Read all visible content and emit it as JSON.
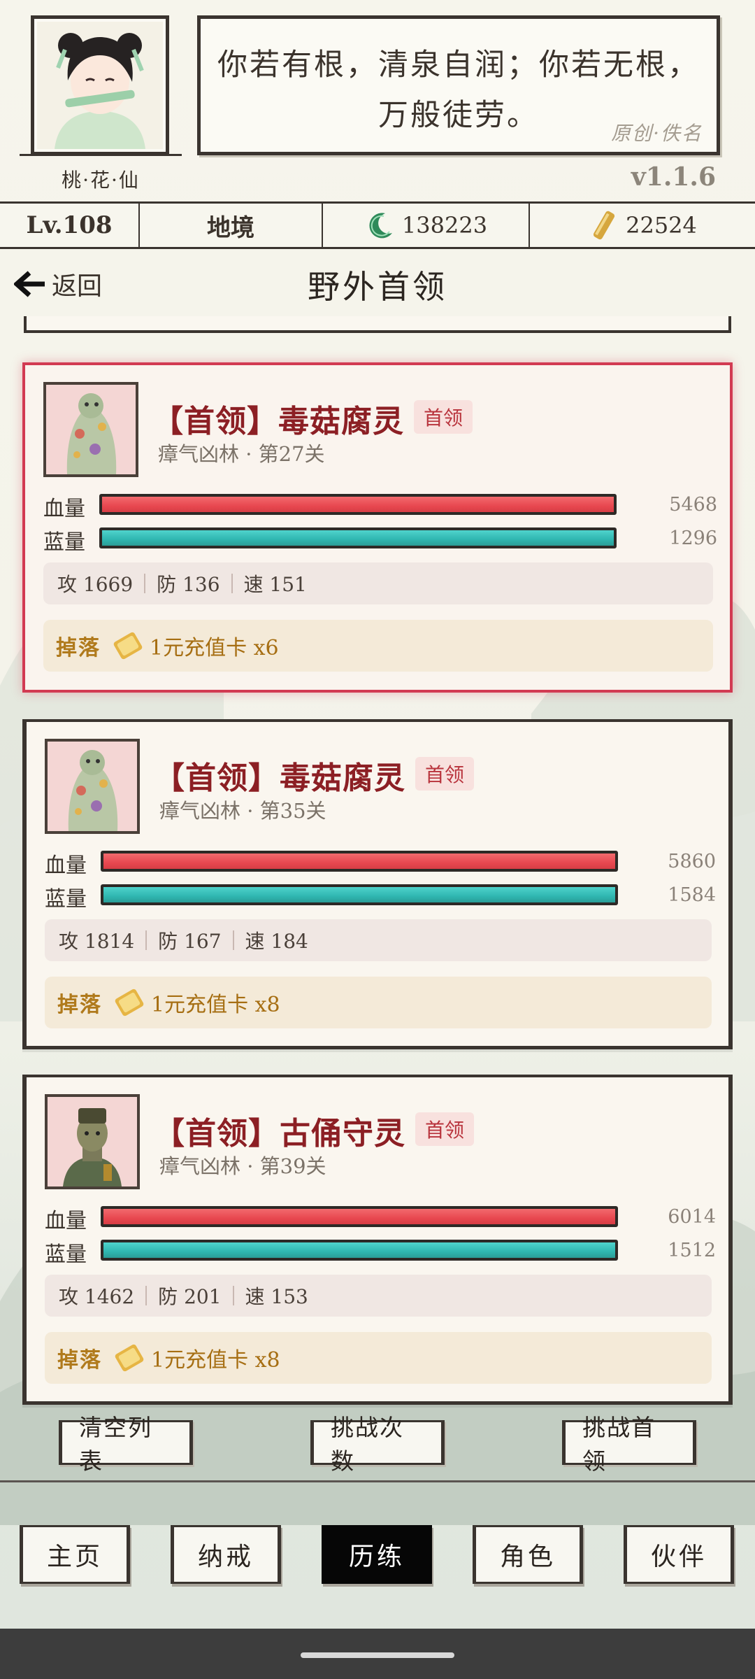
{
  "header": {
    "player_name": "桃·花·仙",
    "quote_line1": "你若有根，清泉自润；你若无根，",
    "quote_line2": "万般徒劳。",
    "quote_author": "原创·佚名",
    "version": "v1.1.6"
  },
  "statbar": {
    "level": "Lv.108",
    "realm": "地境",
    "jade": "138223",
    "scroll": "22524"
  },
  "nav": {
    "back_label": "返回",
    "title": "野外首领"
  },
  "bosses": [
    {
      "name": "【首领】毒菇腐灵",
      "tag": "首领",
      "location": "瘴气凶林 · 第27关",
      "hp_label": "血量",
      "mp_label": "蓝量",
      "hp": "5468",
      "mp": "1296",
      "atk": "攻 1669",
      "def": "防 136",
      "spd": "速 151",
      "drop_label": "掉落",
      "drop": "1元充值卡 x6"
    },
    {
      "name": "【首领】毒菇腐灵",
      "tag": "首领",
      "location": "瘴气凶林 · 第35关",
      "hp_label": "血量",
      "mp_label": "蓝量",
      "hp": "5860",
      "mp": "1584",
      "atk": "攻 1814",
      "def": "防 167",
      "spd": "速 184",
      "drop_label": "掉落",
      "drop": "1元充值卡 x8"
    },
    {
      "name": "【首领】古俑守灵",
      "tag": "首领",
      "location": "瘴气凶林 · 第39关",
      "hp_label": "血量",
      "mp_label": "蓝量",
      "hp": "6014",
      "mp": "1512",
      "atk": "攻 1462",
      "def": "防 201",
      "spd": "速 153",
      "drop_label": "掉落",
      "drop": "1元充值卡 x8"
    }
  ],
  "actions": {
    "clear": "清空列表",
    "count": "挑战次数",
    "challenge": "挑战首领"
  },
  "bottom_nav": [
    "主页",
    "纳戒",
    "历练",
    "角色",
    "伙伴"
  ],
  "active_tab": "历练",
  "colors": {
    "accent_red": "#8c1f24",
    "selected_border": "#d23a52",
    "hp_bar": "#e84850",
    "mp_bar": "#2fb6b0",
    "drop_gold": "#b07a1c"
  }
}
